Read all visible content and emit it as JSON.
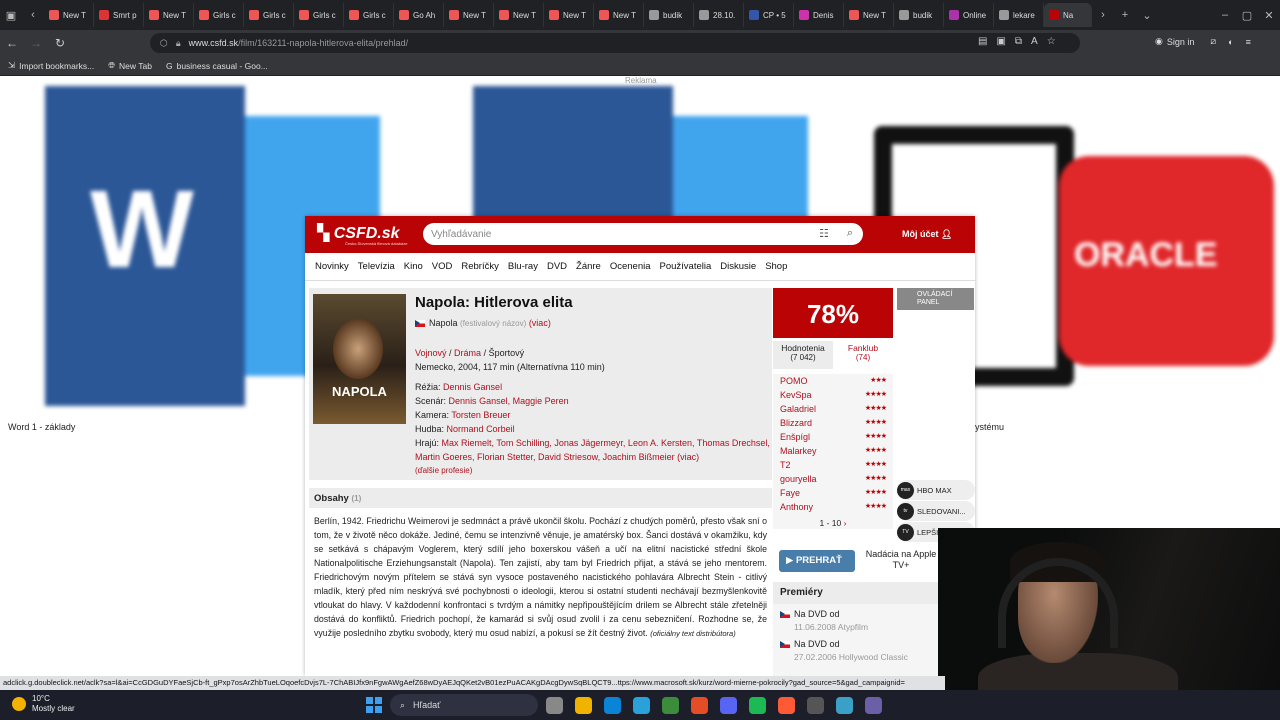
{
  "browser": {
    "tabs": [
      {
        "label": "New T",
        "color": "#e55"
      },
      {
        "label": "Smrt p",
        "color": "#d33"
      },
      {
        "label": "New T",
        "color": "#e55"
      },
      {
        "label": "Girls c",
        "color": "#e55"
      },
      {
        "label": "Girls c",
        "color": "#e55"
      },
      {
        "label": "Girls c",
        "color": "#e55"
      },
      {
        "label": "Girls c",
        "color": "#e55"
      },
      {
        "label": "Go Ah",
        "color": "#e55"
      },
      {
        "label": "New T",
        "color": "#e55"
      },
      {
        "label": "New T",
        "color": "#e55"
      },
      {
        "label": "New T",
        "color": "#e55"
      },
      {
        "label": "New T",
        "color": "#e55"
      },
      {
        "label": "budik",
        "color": "#999"
      },
      {
        "label": "28.10.",
        "color": "#999"
      },
      {
        "label": "CP • 5",
        "color": "#35a"
      },
      {
        "label": "Denis",
        "color": "#c3a"
      },
      {
        "label": "New T",
        "color": "#e55"
      },
      {
        "label": "budik",
        "color": "#999"
      },
      {
        "label": "Online",
        "color": "#a3a"
      },
      {
        "label": "lekare",
        "color": "#999"
      },
      {
        "label": "Na",
        "color": "#ba0305"
      }
    ],
    "url_host": "www.csfd.sk",
    "url_path": "/film/163211-napola-hitlerova-elita/prehlad/",
    "sign_in": "Sign in",
    "bookmarks": [
      "Import bookmarks...",
      "New Tab",
      "business casual - Goo..."
    ]
  },
  "background": {
    "ad_label": "Reklama",
    "caption_left": "Word 1 - základy",
    "caption_right": "ystému",
    "oracle": "ORACLE"
  },
  "csfd": {
    "logo": "CSFD.sk",
    "logo_sub": "Česko-Slovenská filmová databáze",
    "search_placeholder": "Vyhľadávanie",
    "account": "Môj účet",
    "menu": [
      "Novinky",
      "Televízia",
      "Kino",
      "VOD",
      "Rebríčky",
      "Blu-ray",
      "DVD",
      "Žánre",
      "Ocenenia",
      "Používatelia",
      "Diskusie",
      "Shop"
    ],
    "film": {
      "title": "Napola: Hitlerova elita",
      "poster_text": "NAPOLA",
      "alt_title": "Napola",
      "alt_note": "(festivalový názov)",
      "alt_more": "(viac)",
      "genres": [
        "Vojnový",
        "Dráma",
        "Športový"
      ],
      "origin": "Nemecko, 2004, 117 min (Alternatívna 110 min)",
      "directing_label": "Réžia:",
      "directing": "Dennis Gansel",
      "script_label": "Scenár:",
      "script": "Dennis Gansel, Maggie Peren",
      "camera_label": "Kamera:",
      "camera": "Torsten Breuer",
      "music_label": "Hudba:",
      "music": "Normand Corbeil",
      "cast_label": "Hrajú:",
      "cast": "Max Riemelt, Tom Schilling, Jonas Jägermeyr, Leon A. Kersten, Thomas Drechsel, Martin Goeres, Florian Stetter, David Striesow, Joachim Bißmeier",
      "cast_more": "(viac)",
      "more_professions": "(ďalšie profesie)"
    },
    "plot": {
      "heading": "Obsahy",
      "count": "(1)",
      "text": "Berlín, 1942. Friedrichu Weimerovi je sedmnáct a právě ukončil školu. Pochází z chudých poměrů, přesto však sní o tom, že v životě něco dokáže. Jediné, čemu se intenzivně věnuje, je amatérský box. Šanci dostává v okamžiku, kdy se setkává s chápavým Voglerem, který sdílí jeho boxerskou vášeň a učí na elitní nacistické střední škole Nationalpolitische Erziehungsanstalt (Napola). Ten zajistí, aby tam byl Friedrich přijat, a stává se jeho mentorem. Friedrichovým novým přítelem se stává syn vysoce postaveného nacistického pohlavára Albrecht Stein - citlivý mladík, který před ním neskrývá své pochybnosti o ideologii, kterou si ostatní studenti nechávají bezmyšlenkovitě vtloukat do hlavy. V každodenní konfrontaci s tvrdým a námitky nepřipouštějícím drilem se Albrecht stále zřetelněji dostává do konfliktů. Friedrich pochopí, že kamarád si svůj osud zvolil i za cenu sebezničení. Rozhodne se, že využije posledního zbytku svobody, který mu osud nabízí, a pokusí se žít čestný život.",
      "source": "(oficiálny text distribútora)"
    },
    "rating": {
      "percent": "78%",
      "tab_ratings": "Hodnotenia",
      "tab_ratings_count": "(7 042)",
      "tab_fanclub": "Fanklub",
      "tab_fanclub_count": "(74)",
      "users": [
        {
          "name": "POMO",
          "stars": "★★★"
        },
        {
          "name": "KevSpa",
          "stars": "★★★★"
        },
        {
          "name": "Galadriel",
          "stars": "★★★★"
        },
        {
          "name": "Blizzard",
          "stars": "★★★★"
        },
        {
          "name": "Enšpígl",
          "stars": "★★★★"
        },
        {
          "name": "Malarkey",
          "stars": "★★★★"
        },
        {
          "name": "T2",
          "stars": "★★★★"
        },
        {
          "name": "gouryella",
          "stars": "★★★★"
        },
        {
          "name": "Faye",
          "stars": "★★★★"
        },
        {
          "name": "Anthony",
          "stars": "★★★★"
        }
      ],
      "pager": "1 - 10"
    },
    "control_panel": "OVLÁDACÍ PANEL",
    "streams": [
      {
        "icon": "max",
        "label": "HBO MAX"
      },
      {
        "icon": "tv",
        "label": "SLEDOVANI..."
      },
      {
        "icon": "TV",
        "label": "LEPŠIA..."
      }
    ],
    "play_label": "PREHRAŤ",
    "nadacia": "Nadácia na Apple TV+",
    "premieres": {
      "heading": "Premiéry",
      "items": [
        {
          "label": "Na DVD od",
          "date": "11.06.2008 Atypfilm"
        },
        {
          "label": "Na DVD od",
          "date": "27.02.2006 Hollywood Classic"
        }
      ]
    }
  },
  "status_url": "adclick.g.doubleclick.net/aclk?sa=l&ai=CcGDGuDYFaeSjCb-ft_gPxp7osArZhbTueLOqoefcDvjs7L-7ChABIJfx9nFgwAWgAefZ68wDyAEJqQKet2vB01ezPuACAKgDAcgDywSqBLQCT9...ttps://www.macrosoft.sk/kurz/word-mierne-pokrocily?gad_source=5&gad_campaignid=",
  "taskbar": {
    "temp": "10°C",
    "weather": "Mostly clear",
    "search": "Hľadať",
    "apps": [
      "#888",
      "#f0b400",
      "#0a84d6",
      "#2aa1d8",
      "#3b8d3b",
      "#e44d26",
      "#5865f2",
      "#1db954",
      "#ff5a36",
      "#555",
      "#3aa0c8",
      "#6b5fa8"
    ]
  }
}
